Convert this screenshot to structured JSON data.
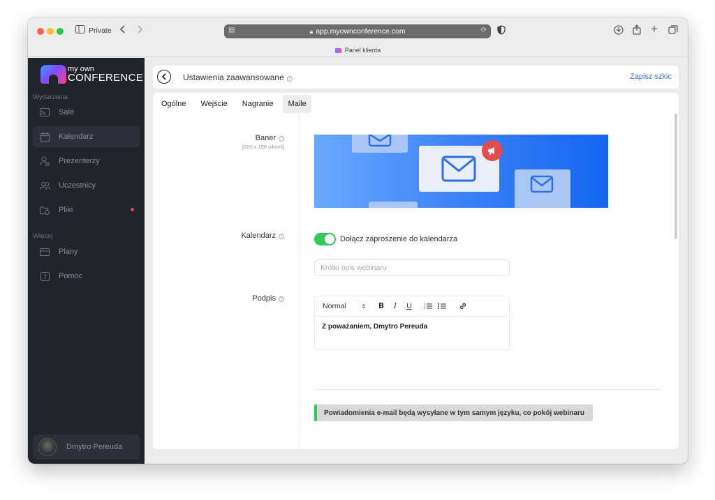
{
  "browser": {
    "private_label": "Private",
    "url": "app.myownconference.com",
    "tab_title": "Panel klienta"
  },
  "sidebar": {
    "logo_small": "my own",
    "logo_big": "CONFERENCE",
    "section_events": "Wydarzenia",
    "section_more": "Więcej",
    "items": [
      {
        "label": "Sale",
        "icon": "cast-icon"
      },
      {
        "label": "Kalendarz",
        "icon": "calendar-icon"
      },
      {
        "label": "Prezenterzy",
        "icon": "presenter-icon"
      },
      {
        "label": "Uczestnicy",
        "icon": "participants-icon"
      },
      {
        "label": "Pliki",
        "icon": "files-icon"
      }
    ],
    "more_items": [
      {
        "label": "Plany",
        "icon": "card-icon"
      },
      {
        "label": "Pomoc",
        "icon": "help-icon"
      }
    ],
    "user_name": "Dmytro Pereuda"
  },
  "header": {
    "title": "Ustawienia zaawansowane",
    "draft_label": "Zapisz szkic"
  },
  "tabs": [
    {
      "label": "Ogólne"
    },
    {
      "label": "Wejście"
    },
    {
      "label": "Nagranie"
    },
    {
      "label": "Maile"
    }
  ],
  "form": {
    "banner_label": "Baner",
    "banner_sub": "[600 x 150 pikseli]",
    "calendar_label": "Kalendarz",
    "calendar_toggle_label": "Dołącz zaproszenie do kalendarza",
    "calendar_toggle_on": true,
    "short_desc_placeholder": "Krótki opis webinaru",
    "signature_label": "Podpis",
    "editor_format": "Normal",
    "signature_text": "Z poważaniem, Dmytro Pereuda",
    "notice_text": "Powiadomienia e-mail będą wysyłane w tym samym języku, co pokój webinaru"
  },
  "colors": {
    "accent_green": "#34c759",
    "link_blue": "#3b6fd4",
    "sidebar_bg": "#22242b"
  }
}
